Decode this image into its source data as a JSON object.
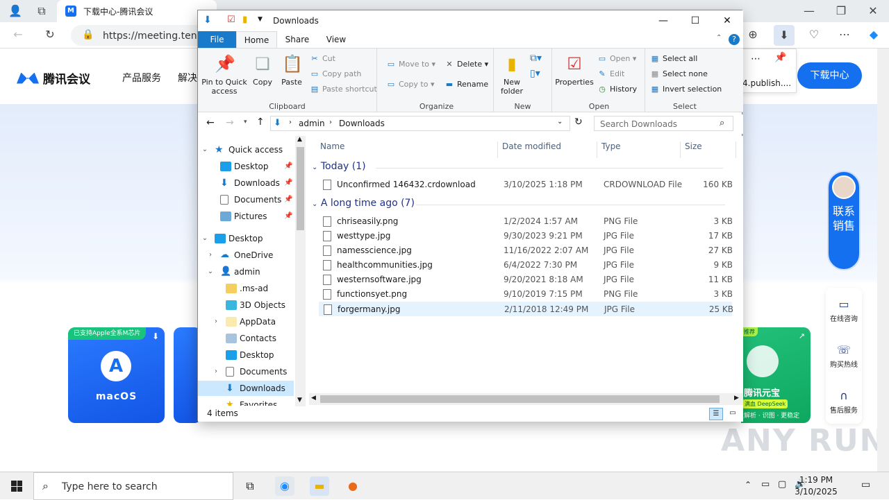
{
  "browser": {
    "tab_title": "下载中心-腾讯会议",
    "url": "https://meeting.tencer"
  },
  "site": {
    "logo_text": "腾讯会议",
    "nav": [
      "产品服务",
      "解决"
    ],
    "download_center": "下载中心",
    "mac_badge": "已支持Apple全系M芯片",
    "mac_label": "macOS",
    "yuanbao_tag_top": "推荐",
    "yuanbao_name": "腾讯元宝",
    "yuanbao_deepseek": "满血 DeepSeek",
    "yuanbao_sub": "解析 · 识图 · 更稳定",
    "sales_text": "联系销售",
    "side": [
      "在线咨询",
      "购买热线",
      "售后服务"
    ],
    "download_file": "4.publish....",
    "watermark": "ANY RUN"
  },
  "explorer": {
    "title": "Downloads",
    "tabs": [
      "File",
      "Home",
      "Share",
      "View"
    ],
    "ribbon": {
      "clipboard": {
        "label": "Clipboard",
        "pin": "Pin to Quick access",
        "copy": "Copy",
        "paste": "Paste",
        "cut": "Cut",
        "copy_path": "Copy path",
        "paste_shortcut": "Paste shortcut"
      },
      "organize": {
        "label": "Organize",
        "move_to": "Move to",
        "copy_to": "Copy to",
        "delete": "Delete",
        "rename": "Rename"
      },
      "new": {
        "label": "New",
        "new_folder": "New folder"
      },
      "open": {
        "label": "Open",
        "properties": "Properties",
        "open": "Open",
        "edit": "Edit",
        "history": "History"
      },
      "select": {
        "label": "Select",
        "select_all": "Select all",
        "select_none": "Select none",
        "invert": "Invert selection"
      }
    },
    "breadcrumb": [
      "admin",
      "Downloads"
    ],
    "search_placeholder": "Search Downloads",
    "nav": {
      "quick_access": "Quick access",
      "qa_items": [
        "Desktop",
        "Downloads",
        "Documents",
        "Pictures"
      ],
      "desktop": "Desktop",
      "onedrive": "OneDrive",
      "admin": "admin",
      "admin_items": [
        ".ms-ad",
        "3D Objects",
        "AppData",
        "Contacts",
        "Desktop",
        "Documents",
        "Downloads",
        "Favorites"
      ]
    },
    "columns": {
      "name": "Name",
      "date": "Date modified",
      "type": "Type",
      "size": "Size"
    },
    "groups": [
      {
        "label": "Today (1)",
        "files": [
          {
            "name": "Unconfirmed 146432.crdownload",
            "date": "3/10/2025 1:18 PM",
            "type": "CRDOWNLOAD File",
            "size": "160 KB"
          }
        ]
      },
      {
        "label": "A long time ago (7)",
        "files": [
          {
            "name": "chriseasily.png",
            "date": "1/2/2024 1:57 AM",
            "type": "PNG File",
            "size": "3 KB"
          },
          {
            "name": "westtype.jpg",
            "date": "9/30/2023 9:21 PM",
            "type": "JPG File",
            "size": "17 KB"
          },
          {
            "name": "namesscience.jpg",
            "date": "11/16/2022 2:07 AM",
            "type": "JPG File",
            "size": "27 KB"
          },
          {
            "name": "healthcommunities.jpg",
            "date": "6/4/2022 7:30 PM",
            "type": "JPG File",
            "size": "9 KB"
          },
          {
            "name": "westernsoftware.jpg",
            "date": "9/20/2021 8:18 AM",
            "type": "JPG File",
            "size": "11 KB"
          },
          {
            "name": "functionsyet.png",
            "date": "9/10/2019 7:15 PM",
            "type": "PNG File",
            "size": "3 KB"
          },
          {
            "name": "forgermany.jpg",
            "date": "2/11/2018 12:49 PM",
            "type": "JPG File",
            "size": "25 KB"
          }
        ]
      }
    ],
    "status": "4 items"
  },
  "taskbar": {
    "search_placeholder": "Type here to search",
    "time": "1:19 PM",
    "date": "3/10/2025"
  }
}
